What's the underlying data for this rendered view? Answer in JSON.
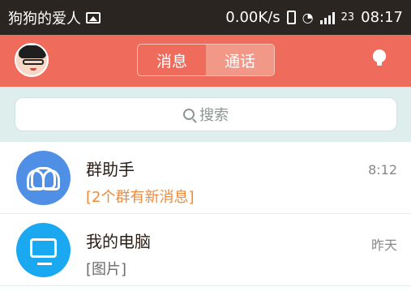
{
  "status": {
    "carrier": "狗狗的爱人",
    "speed": "0.00K/s",
    "network_number": "23",
    "time": "08:17"
  },
  "header": {
    "tabs": [
      {
        "label": "消息",
        "active": false
      },
      {
        "label": "通话",
        "active": true
      }
    ]
  },
  "search": {
    "placeholder": "搜索"
  },
  "conversations": [
    {
      "name": "群助手",
      "subtitle": "[2个群有新消息]",
      "time": "8:12",
      "icon": "group-icon"
    },
    {
      "name": "我的电脑",
      "subtitle": "[图片]",
      "time": "昨天",
      "icon": "computer-icon"
    }
  ],
  "colors": {
    "header": "#ef6c5d",
    "status_bar": "#2b2521",
    "group_badge": "#4f8fe6",
    "computer_badge": "#1aa8f0",
    "highlight_text": "#f08a38"
  }
}
